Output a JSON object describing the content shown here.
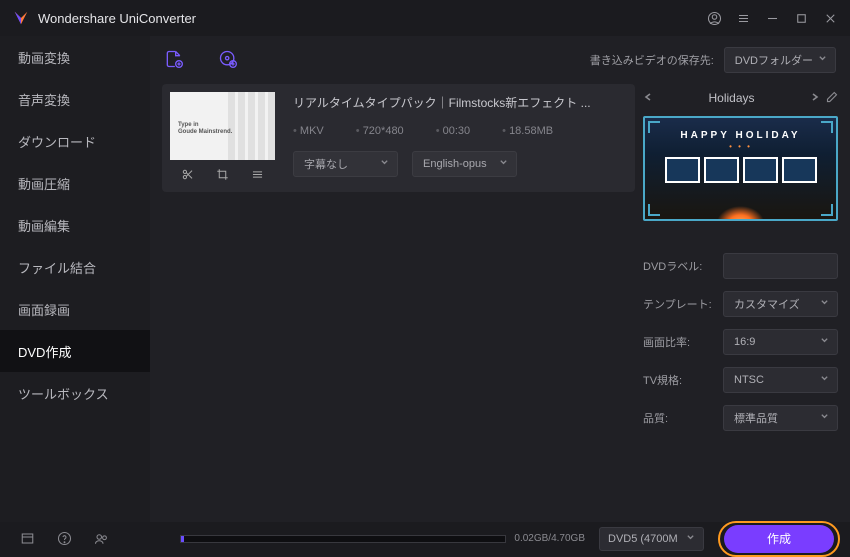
{
  "app_title": "Wondershare UniConverter",
  "sidebar": {
    "items": [
      {
        "label": "動画変換"
      },
      {
        "label": "音声変換"
      },
      {
        "label": "ダウンロード"
      },
      {
        "label": "動画圧縮"
      },
      {
        "label": "動画編集"
      },
      {
        "label": "ファイル結合"
      },
      {
        "label": "画面録画"
      },
      {
        "label": "DVD作成"
      },
      {
        "label": "ツールボックス"
      }
    ]
  },
  "toolbar": {
    "save_label": "書き込みビデオの保存先:",
    "save_target": "DVDフォルダー"
  },
  "file": {
    "title": "リアルタイムタイプパック｜Filmstocks新エフェクト ...",
    "format": "MKV",
    "resolution": "720*480",
    "duration": "00:30",
    "size": "18.58MB",
    "subtitle": "字幕なし",
    "audio": "English-opus",
    "thumb_text1": "Type in",
    "thumb_text2": "Goude Mainstrend."
  },
  "template": {
    "name": "Holidays",
    "banner": "HAPPY HOLIDAY"
  },
  "settings": {
    "rows": [
      {
        "label": "DVDラベル:",
        "value": "",
        "arrow": false
      },
      {
        "label": "テンプレート:",
        "value": "カスタマイズ",
        "arrow": true
      },
      {
        "label": "画面比率:",
        "value": "16:9",
        "arrow": true
      },
      {
        "label": "TV規格:",
        "value": "NTSC",
        "arrow": true
      },
      {
        "label": "品質:",
        "value": "標準品質",
        "arrow": true
      }
    ]
  },
  "footer": {
    "progress_text": "0.02GB/4.70GB",
    "disc_type": "DVD5 (4700M",
    "burn_label": "作成"
  }
}
